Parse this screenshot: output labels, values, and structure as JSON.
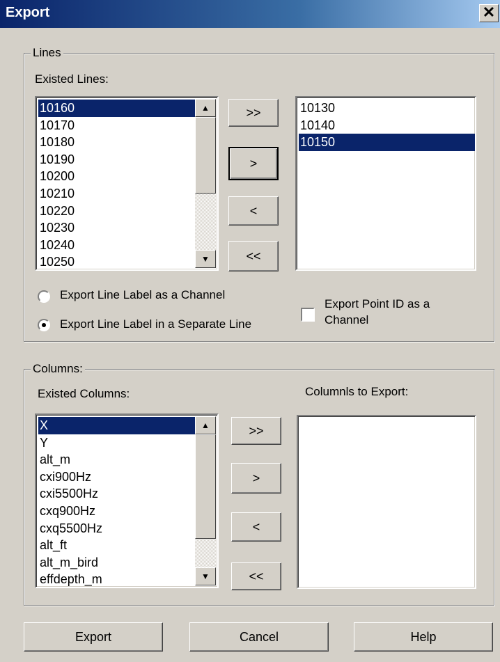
{
  "window": {
    "title": "Export",
    "close_glyph": "✕"
  },
  "lines": {
    "group_label": "Lines",
    "existed_label": "Existed Lines:",
    "existed_items": [
      "10160",
      "10170",
      "10180",
      "10190",
      "10200",
      "10210",
      "10220",
      "10230",
      "10240",
      "10250"
    ],
    "existed_selected_index": 0,
    "selected_items": [
      "10130",
      "10140",
      "10150"
    ],
    "selected_selected_index": 2,
    "buttons": {
      "add_all": ">>",
      "add": ">",
      "remove": "<",
      "remove_all": "<<"
    },
    "radio_channel": "Export Line Label as a Channel",
    "radio_separate": "Export Line Label in a Separate Line",
    "radio_selected": "separate",
    "checkbox_label_1": "Export Point ID as a",
    "checkbox_label_2": "Channel",
    "checkbox_checked": false
  },
  "columns": {
    "group_label": "Columns:",
    "existed_label": "Existed Columns:",
    "export_label": "Columnls to Export:",
    "existed_items": [
      "X",
      "Y",
      "alt_m",
      "cxi900Hz",
      "cxi5500Hz",
      "cxq900Hz",
      "cxq5500Hz",
      "alt_ft",
      "alt_m_bird",
      "effdepth_m"
    ],
    "existed_selected_index": 0,
    "export_items": [],
    "buttons": {
      "add_all": ">>",
      "add": ">",
      "remove": "<",
      "remove_all": "<<"
    }
  },
  "footer": {
    "export": "Export",
    "cancel": "Cancel",
    "help": "Help"
  },
  "scroll_arrows": {
    "up": "▲",
    "down": "▼"
  },
  "colors": {
    "selection": "#0a246a",
    "face": "#d4d0c8",
    "title_start": "#0a246a"
  }
}
